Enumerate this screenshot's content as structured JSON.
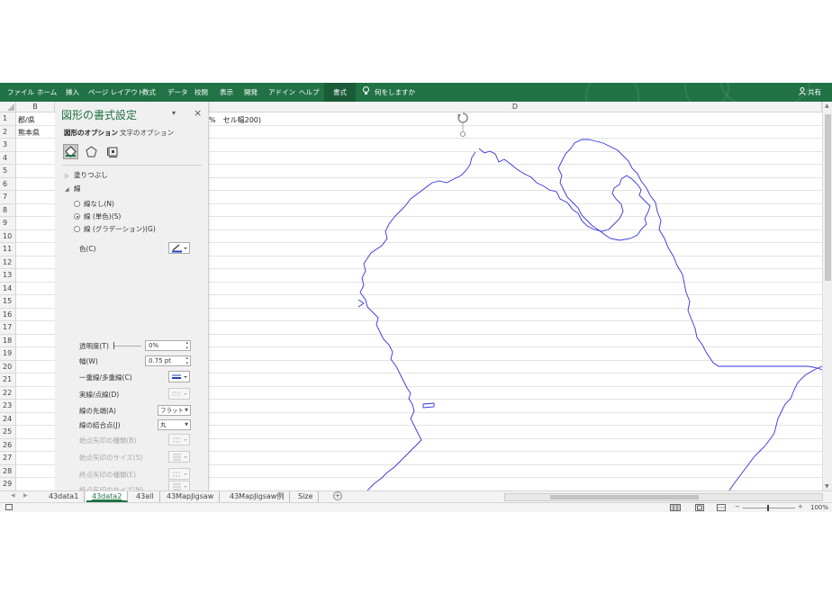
{
  "ribbon": {
    "tabs": [
      "ファイル",
      "ホーム",
      "挿入",
      "ページ レイアウト",
      "数式",
      "データ",
      "校閲",
      "表示",
      "開発",
      "アドイン",
      "ヘルプ",
      "書式"
    ],
    "active_tab": "書式",
    "tell_me": "何をしますか",
    "share": "共有"
  },
  "grid": {
    "columns": [
      "B",
      "D"
    ],
    "rows": [
      "1",
      "2",
      "3",
      "4",
      "5",
      "6",
      "7",
      "8",
      "9",
      "10",
      "11",
      "12",
      "13",
      "14",
      "15",
      "16",
      "17",
      "18",
      "19",
      "20",
      "21",
      "22",
      "23",
      "24",
      "25",
      "26",
      "27",
      "28",
      "29"
    ],
    "cells": {
      "b1": "郡/県",
      "b2": "熊本県",
      "c1_partial": "%　セル幅200)"
    }
  },
  "format_pane": {
    "title": "図形の書式設定",
    "tabs": [
      "図形のオプション",
      "文字のオプション"
    ],
    "sections": {
      "fill": "塗りつぶし",
      "line": "線"
    },
    "line_options": [
      "線なし(N)",
      "線 (単色)(S)",
      "線 (グラデーション)(G)"
    ],
    "selected_line_option": 1,
    "labels": {
      "color": "色(C)",
      "transparency": "透明度(T)",
      "width": "幅(W)",
      "compound": "一重線/多重線(C)",
      "dash": "実線/点線(D)",
      "cap": "線の先端(A)",
      "join": "線の結合点(J)",
      "begin_arrow_type": "始点矢印の種類(B)",
      "begin_arrow_size": "始点矢印のサイズ(S)",
      "end_arrow_type": "終点矢印の種類(E)",
      "end_arrow_size": "終点矢印のサイズ(N)"
    },
    "values": {
      "transparency": "0%",
      "width": "0.75 pt",
      "cap": "フラット",
      "join": "丸"
    },
    "line_color": "#1f3fbf"
  },
  "sheet_tabs": [
    "43data1",
    "43data2",
    "43all",
    "43MapJigsaw",
    "43MapJigsaw例",
    "Size"
  ],
  "active_sheet": "43data2",
  "status": {
    "zoom": "100%"
  },
  "colors": {
    "ribbon": "#217346",
    "shape_outline": "#3333dd"
  }
}
